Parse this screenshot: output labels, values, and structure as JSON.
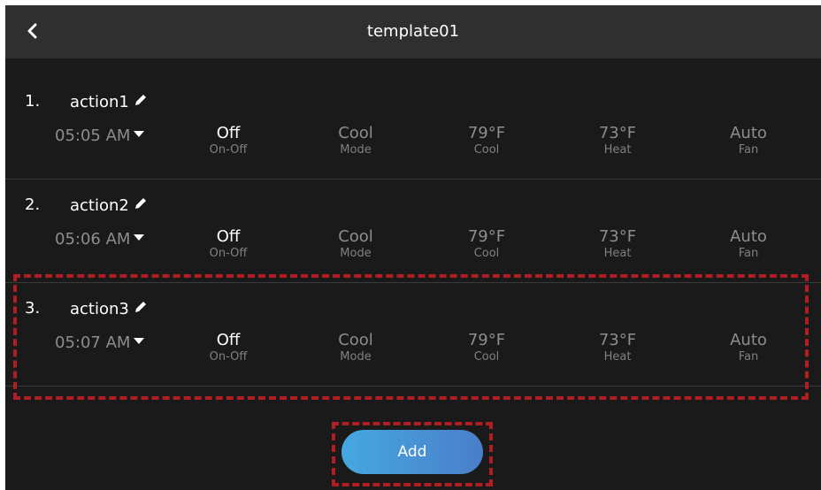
{
  "header": {
    "title": "template01"
  },
  "actions": [
    {
      "index": "1.",
      "name": "action1",
      "time": "05:05 AM",
      "values": [
        {
          "value": "Off",
          "label": "On-Off"
        },
        {
          "value": "Cool",
          "label": "Mode"
        },
        {
          "value": "79°F",
          "label": "Cool"
        },
        {
          "value": "73°F",
          "label": "Heat"
        },
        {
          "value": "Auto",
          "label": "Fan"
        }
      ]
    },
    {
      "index": "2.",
      "name": "action2",
      "time": "05:06 AM",
      "values": [
        {
          "value": "Off",
          "label": "On-Off"
        },
        {
          "value": "Cool",
          "label": "Mode"
        },
        {
          "value": "79°F",
          "label": "Cool"
        },
        {
          "value": "73°F",
          "label": "Heat"
        },
        {
          "value": "Auto",
          "label": "Fan"
        }
      ]
    },
    {
      "index": "3.",
      "name": "action3",
      "time": "05:07 AM",
      "values": [
        {
          "value": "Off",
          "label": "On-Off"
        },
        {
          "value": "Cool",
          "label": "Mode"
        },
        {
          "value": "79°F",
          "label": "Cool"
        },
        {
          "value": "73°F",
          "label": "Heat"
        },
        {
          "value": "Auto",
          "label": "Fan"
        }
      ]
    }
  ],
  "add_button": {
    "label": "Add"
  },
  "highlight_color": "#b01e23",
  "accent_color": "#4a9ad8"
}
